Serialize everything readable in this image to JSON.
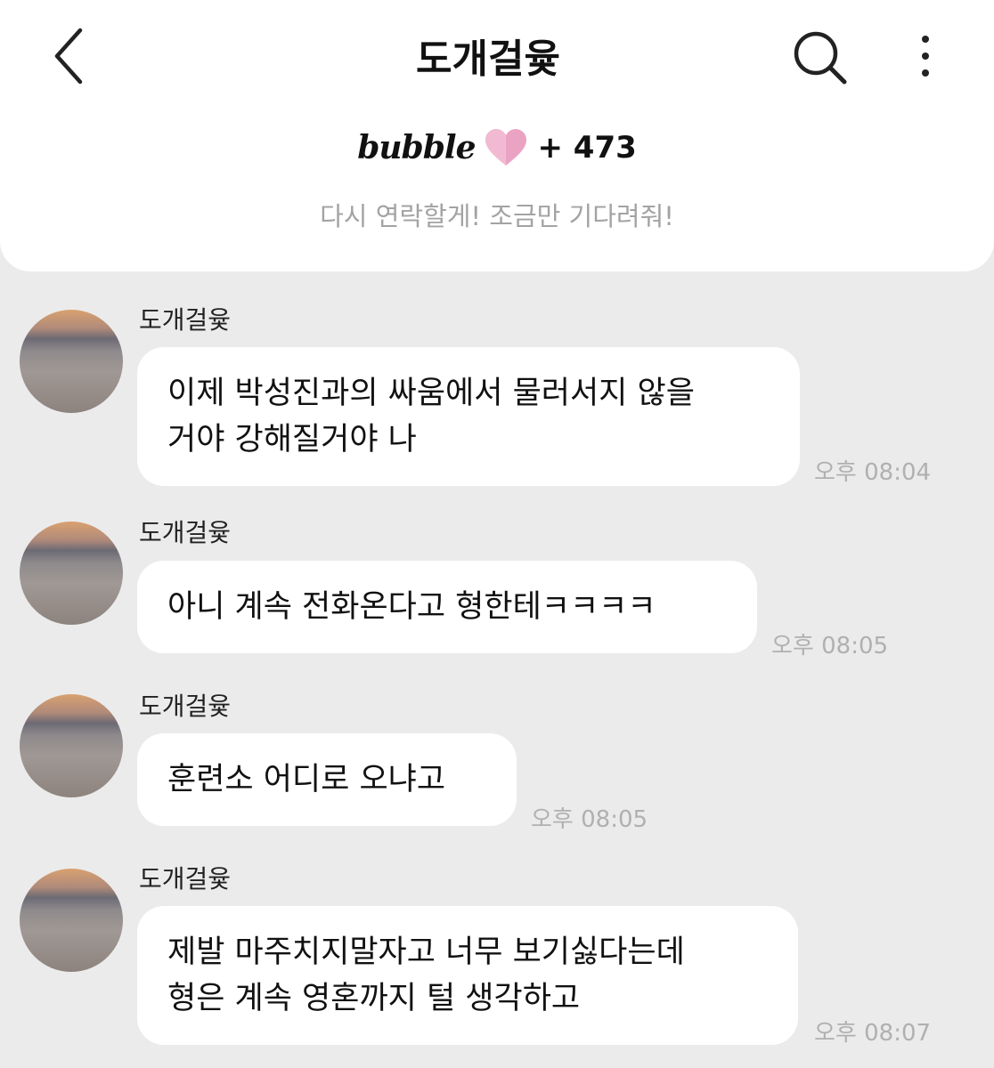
{
  "header": {
    "title": "도개걸윷",
    "back_icon": "chevron-left-icon",
    "search_icon": "search-icon",
    "more_icon": "more-vertical-icon"
  },
  "bubble_bar": {
    "logo": "bubble",
    "heart_icon": "heart-icon",
    "count": "+ 473",
    "notice": "다시 연락할게! 조금만 기다려줘!"
  },
  "messages": [
    {
      "sender": "도개걸윷",
      "text": "이제 박성진과의 싸움에서 물러서지 않을\n거야 강해질거야 나",
      "time": "오후 08:04"
    },
    {
      "sender": "도개걸윷",
      "text": "아니 계속 전화온다고 형한테ㅋㅋㅋㅋ",
      "time": "오후 08:05"
    },
    {
      "sender": "도개걸윷",
      "text": "훈련소 어디로 오냐고",
      "time": "오후 08:05"
    },
    {
      "sender": "도개걸윷",
      "text": "제발 마주치지말자고 너무 보기싫다는데\n형은 계속 영혼까지 털 생각하고",
      "time": "오후 08:07"
    }
  ],
  "colors": {
    "background": "#ebebeb",
    "bubble": "#ffffff",
    "heart": "#e58fb4",
    "timestamp": "#b0b0b0"
  }
}
